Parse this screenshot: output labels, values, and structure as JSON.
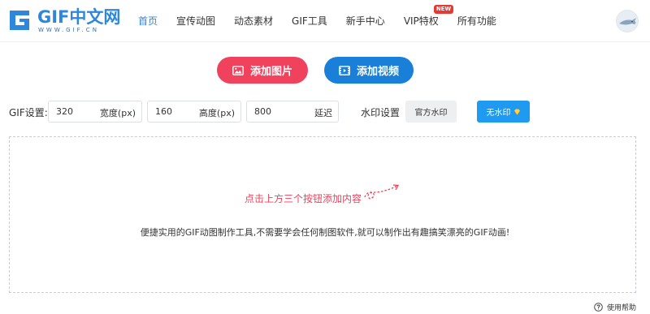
{
  "header": {
    "logo_text": "GIF中文网",
    "logo_sub": "WWW.GIF.CN",
    "nav": [
      {
        "label": "首页",
        "active": true
      },
      {
        "label": "宣传动图",
        "active": false
      },
      {
        "label": "动态素材",
        "active": false
      },
      {
        "label": "GIF工具",
        "active": false
      },
      {
        "label": "新手中心",
        "active": false
      },
      {
        "label": "VIP特权",
        "active": false,
        "badge": "NEW"
      },
      {
        "label": "所有功能",
        "active": false
      }
    ],
    "avatar_icon": "shark-avatar"
  },
  "actions": {
    "add_image": "添加图片",
    "add_video": "添加视频",
    "add_image_icon": "image-icon",
    "add_video_icon": "film-icon"
  },
  "settings": {
    "label": "GIF设置:",
    "width": {
      "value": "320",
      "unit": "宽度(px)"
    },
    "height": {
      "value": "160",
      "unit": "高度(px)"
    },
    "delay": {
      "value": "800",
      "unit": "延迟"
    },
    "watermark_label": "水印设置",
    "watermark_official": "官方水印",
    "watermark_none": "无水印",
    "watermark_none_icon": "diamond-icon"
  },
  "dropzone": {
    "hint": "点击上方三个按钮添加内容",
    "description": "便捷实用的GIF动图制作工具,不需要学会任何制图软件,就可以制作出有趣搞笑漂亮的GIF动画!"
  },
  "help": {
    "label": "使用帮助",
    "icon": "question-circle-icon"
  },
  "colors": {
    "brand_blue": "#2f87dc",
    "image_button": "#f0425d",
    "video_button": "#1a7fd8",
    "no_watermark_button": "#1e9bf0",
    "hint_text": "#f0425d"
  }
}
